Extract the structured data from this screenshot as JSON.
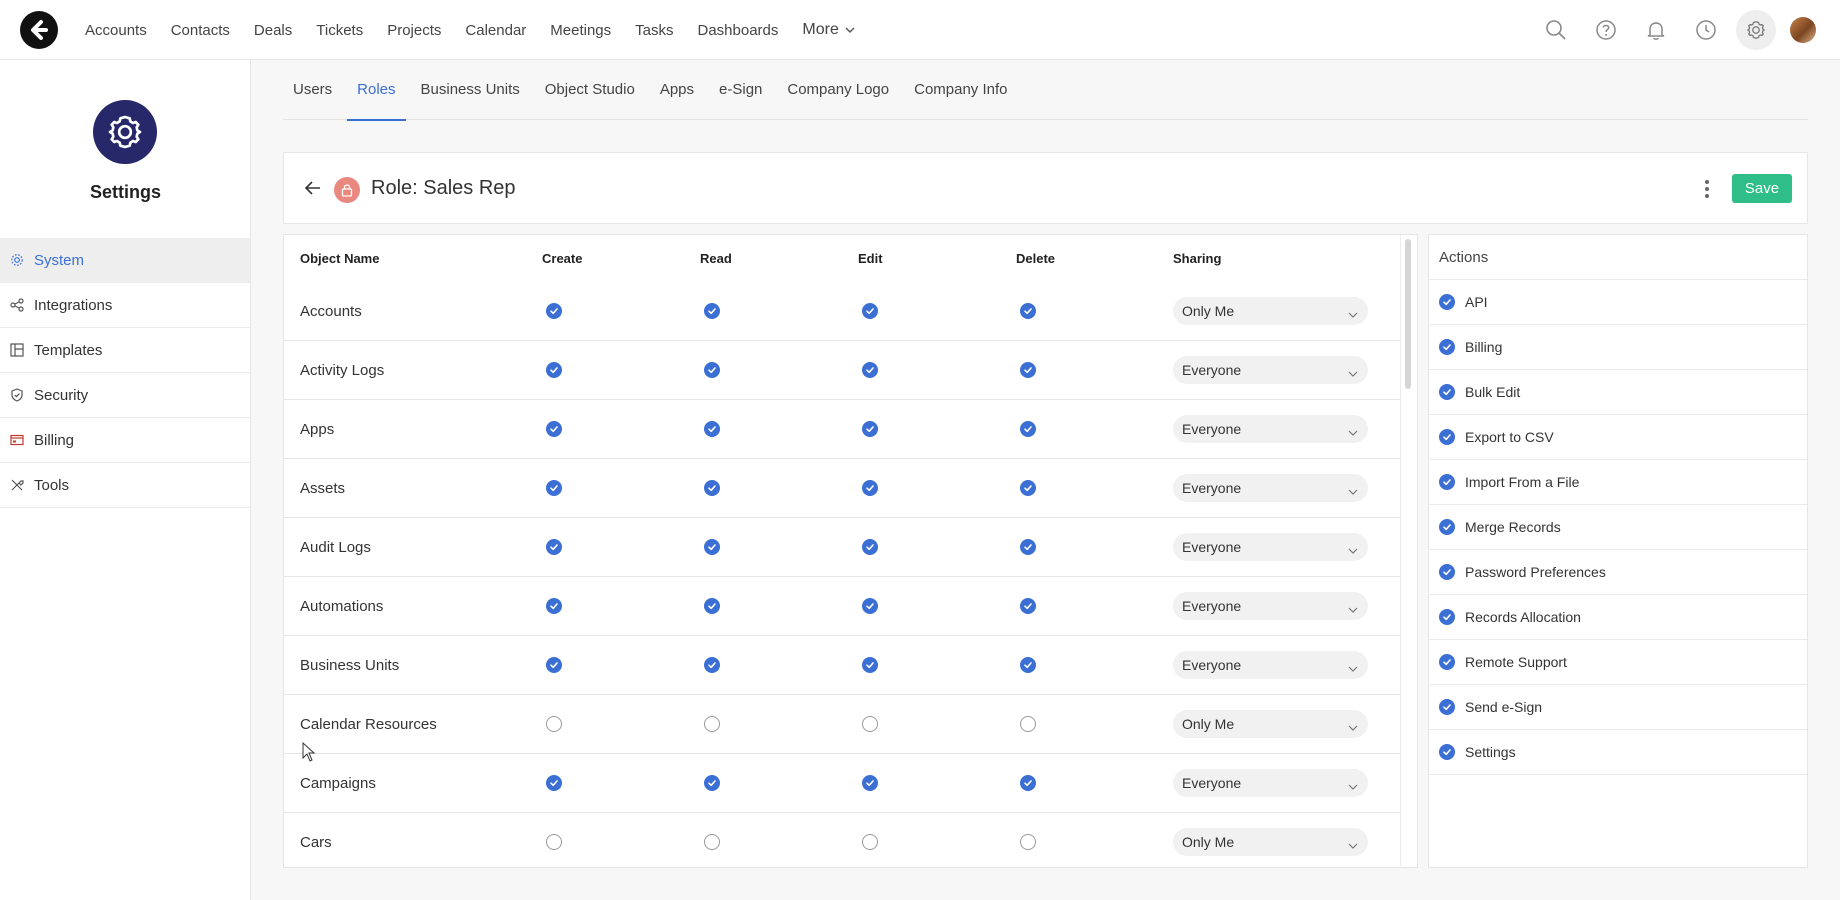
{
  "nav": {
    "items": [
      "Accounts",
      "Contacts",
      "Deals",
      "Tickets",
      "Projects",
      "Calendar",
      "Meetings",
      "Tasks",
      "Dashboards"
    ],
    "more_label": "More"
  },
  "sidebar": {
    "title": "Settings",
    "items": [
      {
        "label": "System",
        "icon": "gear-icon",
        "active": true
      },
      {
        "label": "Integrations",
        "icon": "share-icon",
        "active": false
      },
      {
        "label": "Templates",
        "icon": "template-icon",
        "active": false
      },
      {
        "label": "Security",
        "icon": "shield-icon",
        "active": false
      },
      {
        "label": "Billing",
        "icon": "billing-icon",
        "active": false
      },
      {
        "label": "Tools",
        "icon": "tools-icon",
        "active": false
      }
    ]
  },
  "tabs": [
    {
      "label": "Users",
      "active": false
    },
    {
      "label": "Roles",
      "active": true
    },
    {
      "label": "Business Units",
      "active": false
    },
    {
      "label": "Object Studio",
      "active": false
    },
    {
      "label": "Apps",
      "active": false
    },
    {
      "label": "e-Sign",
      "active": false
    },
    {
      "label": "Company Logo",
      "active": false
    },
    {
      "label": "Company Info",
      "active": false
    }
  ],
  "header": {
    "title": "Role: Sales Rep",
    "save_label": "Save"
  },
  "table": {
    "columns": [
      "Object Name",
      "Create",
      "Read",
      "Edit",
      "Delete",
      "Sharing"
    ],
    "rows": [
      {
        "name": "Accounts",
        "create": true,
        "read": true,
        "edit": true,
        "delete": true,
        "sharing": "Only Me"
      },
      {
        "name": "Activity Logs",
        "create": true,
        "read": true,
        "edit": true,
        "delete": true,
        "sharing": "Everyone"
      },
      {
        "name": "Apps",
        "create": true,
        "read": true,
        "edit": true,
        "delete": true,
        "sharing": "Everyone"
      },
      {
        "name": "Assets",
        "create": true,
        "read": true,
        "edit": true,
        "delete": true,
        "sharing": "Everyone"
      },
      {
        "name": "Audit Logs",
        "create": true,
        "read": true,
        "edit": true,
        "delete": true,
        "sharing": "Everyone"
      },
      {
        "name": "Automations",
        "create": true,
        "read": true,
        "edit": true,
        "delete": true,
        "sharing": "Everyone"
      },
      {
        "name": "Business Units",
        "create": true,
        "read": true,
        "edit": true,
        "delete": true,
        "sharing": "Everyone"
      },
      {
        "name": "Calendar Resources",
        "create": false,
        "read": false,
        "edit": false,
        "delete": false,
        "sharing": "Only Me"
      },
      {
        "name": "Campaigns",
        "create": true,
        "read": true,
        "edit": true,
        "delete": true,
        "sharing": "Everyone"
      },
      {
        "name": "Cars",
        "create": false,
        "read": false,
        "edit": false,
        "delete": false,
        "sharing": "Only Me"
      }
    ]
  },
  "actions": {
    "title": "Actions",
    "items": [
      {
        "label": "API",
        "checked": true
      },
      {
        "label": "Billing",
        "checked": true
      },
      {
        "label": "Bulk Edit",
        "checked": true
      },
      {
        "label": "Export to CSV",
        "checked": true
      },
      {
        "label": "Import From a File",
        "checked": true
      },
      {
        "label": "Merge Records",
        "checked": true
      },
      {
        "label": "Password Preferences",
        "checked": true
      },
      {
        "label": "Records Allocation",
        "checked": true
      },
      {
        "label": "Remote Support",
        "checked": true
      },
      {
        "label": "Send e-Sign",
        "checked": true
      },
      {
        "label": "Settings",
        "checked": true
      }
    ]
  },
  "colors": {
    "accent": "#3b6fd4",
    "save_button": "#2fbe87",
    "settings_badge": "#26286a",
    "role_icon": "#e9887f"
  }
}
